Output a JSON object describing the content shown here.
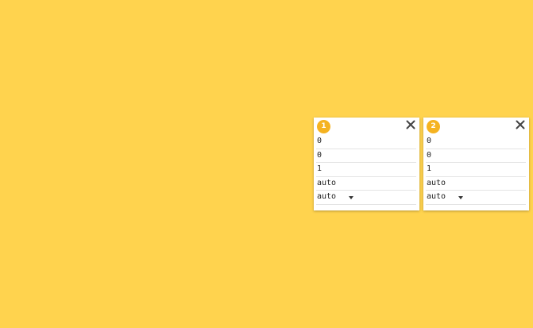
{
  "panels": [
    {
      "badge": "1",
      "fields": [
        "0",
        "0",
        "1",
        "auto"
      ],
      "select_value": "auto"
    },
    {
      "badge": "2",
      "fields": [
        "0",
        "0",
        "1",
        "auto"
      ],
      "select_value": "auto"
    }
  ],
  "icons": {
    "close": "close-icon",
    "dropdown": "caret-down-icon"
  },
  "colors": {
    "background": "#ffd34e",
    "badge": "#f5b321",
    "card": "#ffffff"
  }
}
